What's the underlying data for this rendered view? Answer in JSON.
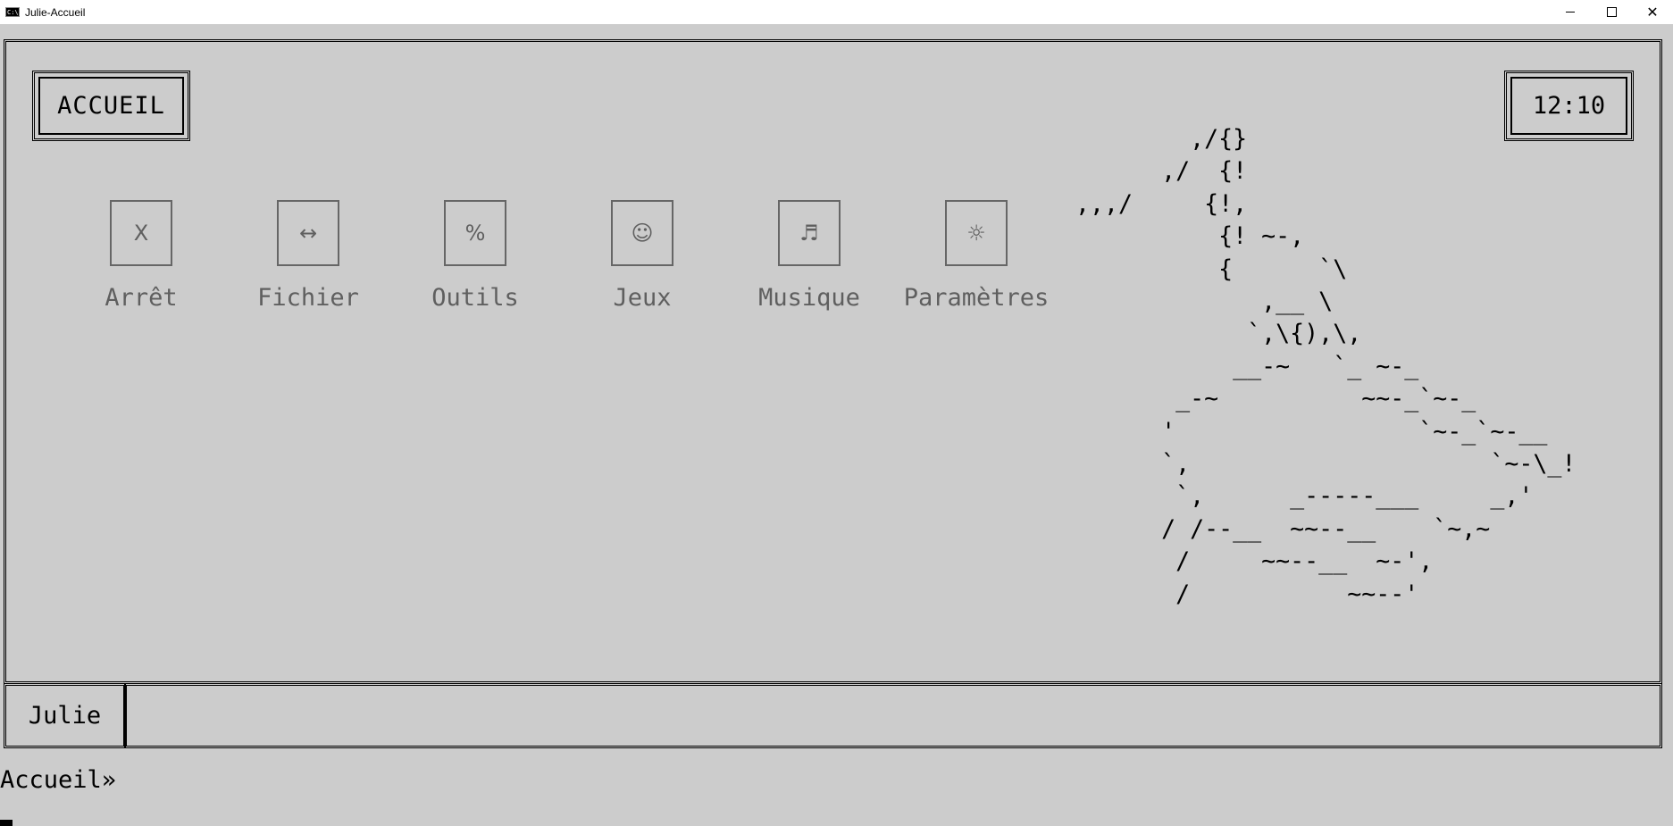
{
  "window": {
    "title": "Julie-Accueil",
    "icon": "console-icon",
    "controls": {
      "minimize": "minimize-icon",
      "maximize": "maximize-icon",
      "close": "✕"
    }
  },
  "header": {
    "title": "ACCUEIL",
    "clock": "12:10"
  },
  "menu": [
    {
      "icon": "X",
      "label": "Arrêt"
    },
    {
      "icon": "↔",
      "label": "Fichier"
    },
    {
      "icon": "%",
      "label": "Outils"
    },
    {
      "icon": "☺",
      "label": "Jeux"
    },
    {
      "icon": "♬",
      "label": "Musique"
    },
    {
      "icon": "☼",
      "label": "Paramètres"
    }
  ],
  "art": "        ,/{}\n      ,/  {!\n,,,/     {!,\n          {! ~-,\n          {      `\\\n             ,__ \\\n            `,\\{),\\,\n           __-~   `_ ~-_\n       _-~          ~~-_`~-_\n      '                 `~-_`~-__\n      `,                     `~-\\_!\n       `,      _-----___     _,'\n      / /--__  ~~--__    `~,~\n       /     ~~--__  ~-',\n       /           ~~--'",
  "status": {
    "user": "Julie",
    "message": ""
  },
  "console": {
    "prompt": "Accueil»"
  },
  "colors": {
    "background": "#cccccc",
    "inactive_text": "#5f5f5f",
    "border": "#000000"
  }
}
